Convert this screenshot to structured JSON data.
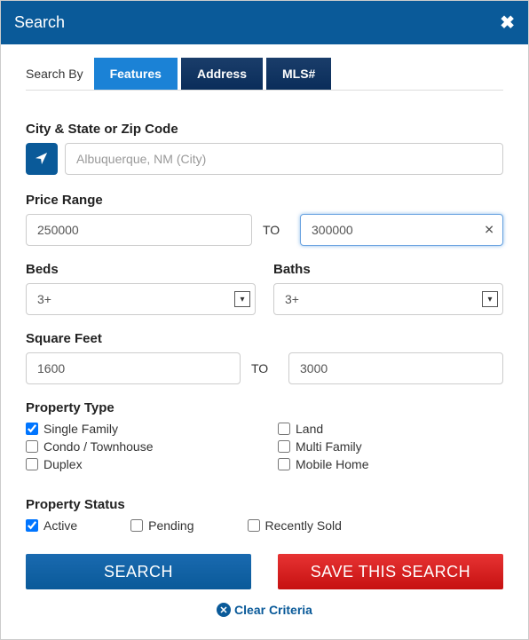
{
  "header": {
    "title": "Search"
  },
  "tabs": {
    "label": "Search By",
    "items": [
      "Features",
      "Address",
      "MLS#"
    ],
    "active_index": 0
  },
  "location": {
    "label": "City & State or Zip Code",
    "placeholder": "Albuquerque, NM (City)"
  },
  "price": {
    "label": "Price Range",
    "min": "250000",
    "max": "300000",
    "to_label": "TO"
  },
  "beds": {
    "label": "Beds",
    "value": "3+"
  },
  "baths": {
    "label": "Baths",
    "value": "3+"
  },
  "sqft": {
    "label": "Square Feet",
    "min": "1600",
    "max": "3000",
    "to_label": "TO"
  },
  "ptype": {
    "label": "Property Type",
    "col1": [
      {
        "label": "Single Family",
        "checked": true
      },
      {
        "label": "Condo / Townhouse",
        "checked": false
      },
      {
        "label": "Duplex",
        "checked": false
      }
    ],
    "col2": [
      {
        "label": "Land",
        "checked": false
      },
      {
        "label": "Multi Family",
        "checked": false
      },
      {
        "label": "Mobile Home",
        "checked": false
      }
    ]
  },
  "status": {
    "label": "Property Status",
    "items": [
      {
        "label": "Active",
        "checked": true
      },
      {
        "label": "Pending",
        "checked": false
      },
      {
        "label": "Recently Sold",
        "checked": false
      }
    ]
  },
  "buttons": {
    "search": "SEARCH",
    "save": "SAVE THIS SEARCH",
    "clear": "Clear Criteria"
  }
}
